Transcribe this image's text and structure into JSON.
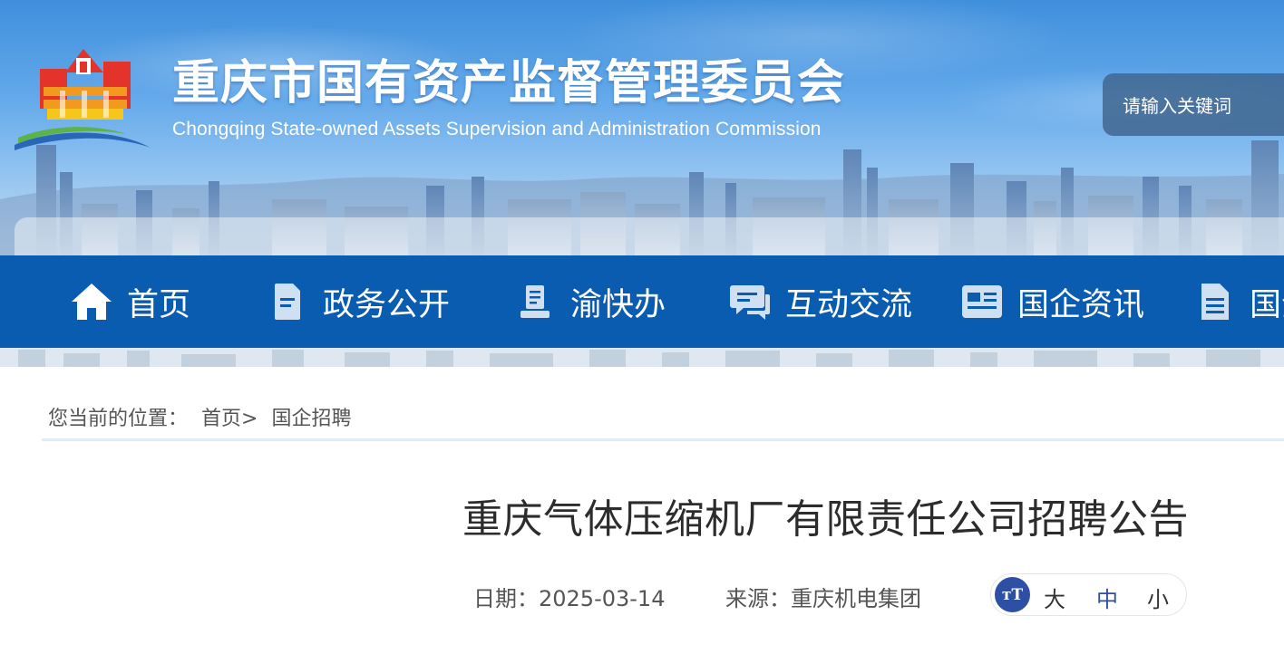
{
  "header": {
    "title": "重庆市国有资产监督管理委员会",
    "subtitle": "Chongqing State-owned Assets Supervision and Administration Commission",
    "logo_icon": "sasac-building-logo"
  },
  "search": {
    "placeholder": "请输入关键词"
  },
  "nav": {
    "items": [
      {
        "label": "首页",
        "icon": "home-icon"
      },
      {
        "label": "政务公开",
        "icon": "document-icon"
      },
      {
        "label": "渝快办",
        "icon": "service-desk-icon"
      },
      {
        "label": "互动交流",
        "icon": "chat-icon"
      },
      {
        "label": "国企资讯",
        "icon": "news-card-icon"
      },
      {
        "label": "国企",
        "icon": "file-list-icon"
      }
    ],
    "background_color": "#0a5cb0"
  },
  "breadcrumb": {
    "prefix": "您当前的位置：",
    "home": "首页",
    "separator": ">",
    "current": "国企招聘"
  },
  "article": {
    "title": "重庆气体压缩机厂有限责任公司招聘公告",
    "date": "日期：2025-03-14",
    "source": "来源：重庆机电集团"
  },
  "font_size_control": {
    "icon_text": "тT",
    "large": "大",
    "medium": "中",
    "small": "小",
    "active": "中",
    "accent_color": "#2d4fa4"
  }
}
